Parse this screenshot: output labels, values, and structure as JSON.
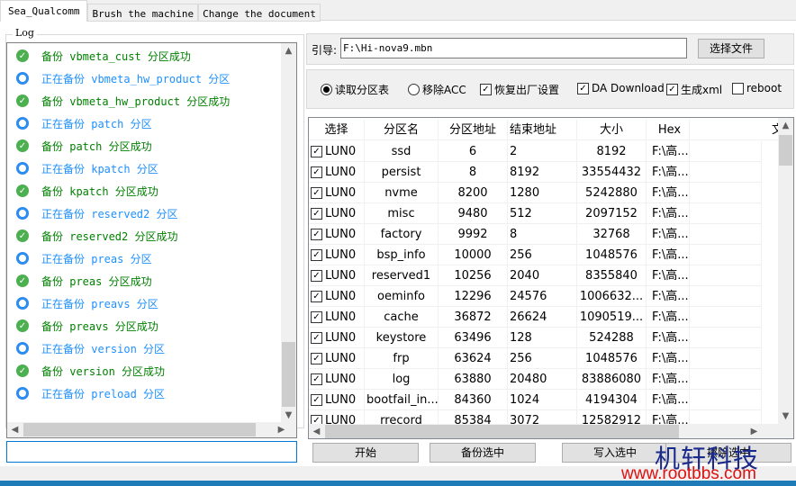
{
  "tabs": [
    {
      "label": "Sea_Qualcomm",
      "active": true
    },
    {
      "label": "Brush the machine"
    },
    {
      "label": "Change the document"
    }
  ],
  "log": {
    "title": "Log",
    "items": [
      {
        "status": "success",
        "text": "备份 vbmeta_cust 分区成功"
      },
      {
        "status": "running",
        "text": "正在备份 vbmeta_hw_product 分区"
      },
      {
        "status": "success",
        "text": "备份 vbmeta_hw_product 分区成功"
      },
      {
        "status": "running",
        "text": "正在备份 patch 分区"
      },
      {
        "status": "success",
        "text": "备份 patch 分区成功"
      },
      {
        "status": "running",
        "text": "正在备份 kpatch 分区"
      },
      {
        "status": "success",
        "text": "备份 kpatch 分区成功"
      },
      {
        "status": "running",
        "text": "正在备份 reserved2 分区"
      },
      {
        "status": "success",
        "text": "备份 reserved2 分区成功"
      },
      {
        "status": "running",
        "text": "正在备份 preas 分区"
      },
      {
        "status": "success",
        "text": "备份 preas 分区成功"
      },
      {
        "status": "running",
        "text": "正在备份 preavs 分区"
      },
      {
        "status": "success",
        "text": "备份 preavs 分区成功"
      },
      {
        "status": "running",
        "text": "正在备份 version 分区"
      },
      {
        "status": "success",
        "text": "备份 version 分区成功"
      },
      {
        "status": "running",
        "text": "正在备份 preload 分区"
      }
    ],
    "input_value": ""
  },
  "boot": {
    "label": "引导:",
    "value": "F:\\Hi-nova9.mbn",
    "select_file": "选择文件"
  },
  "options": [
    {
      "type": "radio",
      "label": "读取分区表",
      "checked": true
    },
    {
      "type": "radio",
      "label": "移除ACC",
      "checked": false
    },
    {
      "type": "checkbox",
      "label": "恢复出厂设置",
      "checked": true
    },
    {
      "type": "checkbox",
      "label": "DA Download",
      "checked": true
    },
    {
      "type": "checkbox",
      "label": "生成xml",
      "checked": true
    },
    {
      "type": "checkbox",
      "label": "reboot",
      "checked": false
    }
  ],
  "table": {
    "headers": [
      "选择",
      "分区名",
      "分区地址",
      "结束地址",
      "大小",
      "Hex",
      "文件"
    ],
    "rows": [
      [
        "LUN0",
        "ssd",
        "6",
        "2",
        "8192",
        "F:\\高..."
      ],
      [
        "LUN0",
        "persist",
        "8",
        "8192",
        "33554432",
        "F:\\高..."
      ],
      [
        "LUN0",
        "nvme",
        "8200",
        "1280",
        "5242880",
        "F:\\高..."
      ],
      [
        "LUN0",
        "misc",
        "9480",
        "512",
        "2097152",
        "F:\\高..."
      ],
      [
        "LUN0",
        "factory",
        "9992",
        "8",
        "32768",
        "F:\\高..."
      ],
      [
        "LUN0",
        "bsp_info",
        "10000",
        "256",
        "1048576",
        "F:\\高..."
      ],
      [
        "LUN0",
        "reserved1",
        "10256",
        "2040",
        "8355840",
        "F:\\高..."
      ],
      [
        "LUN0",
        "oeminfo",
        "12296",
        "24576",
        "1006632...",
        "F:\\高..."
      ],
      [
        "LUN0",
        "cache",
        "36872",
        "26624",
        "1090519...",
        "F:\\高..."
      ],
      [
        "LUN0",
        "keystore",
        "63496",
        "128",
        "524288",
        "F:\\高..."
      ],
      [
        "LUN0",
        "frp",
        "63624",
        "256",
        "1048576",
        "F:\\高..."
      ],
      [
        "LUN0",
        "log",
        "63880",
        "20480",
        "83886080",
        "F:\\高..."
      ],
      [
        "LUN0",
        "bootfail_in...",
        "84360",
        "1024",
        "4194304",
        "F:\\高..."
      ],
      [
        "LUN0",
        "rrecord",
        "85384",
        "3072",
        "12582912",
        "F:\\高..."
      ]
    ]
  },
  "buttons": {
    "start": "开始",
    "backup": "备份选中",
    "write": "写入选中",
    "erase": "擦除选中"
  },
  "watermark": {
    "name": "机轩科技",
    "url": "www.rootbbs.com"
  }
}
